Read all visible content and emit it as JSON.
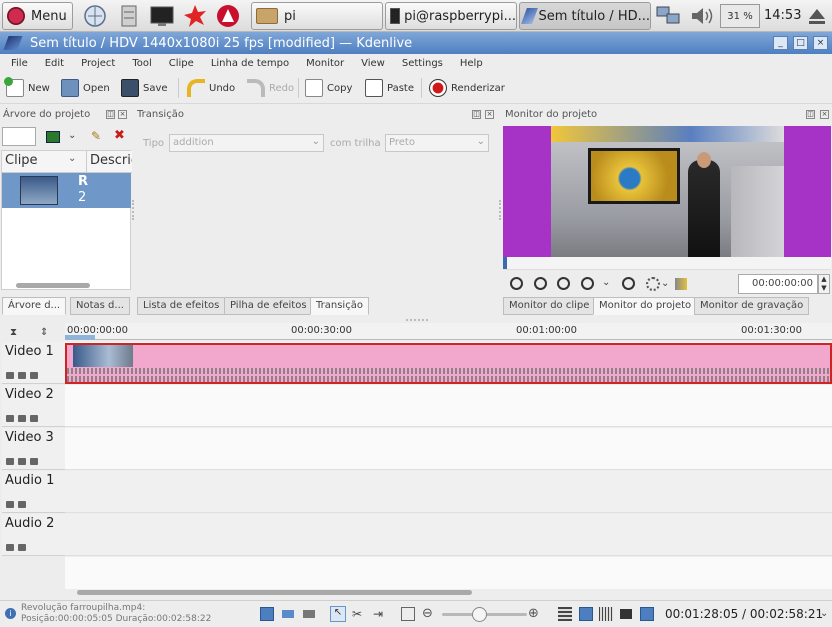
{
  "taskbar": {
    "menu_label": "Menu",
    "folder_label": "pi",
    "terminal_label": "pi@raspberrypi...",
    "kdenlive_label": "Sem título / HD...",
    "battery": "31 %",
    "clock": "14:53"
  },
  "window": {
    "title": "Sem título / HDV 1440x1080i 25 fps [modified] — Kdenlive"
  },
  "menu": [
    "File",
    "Edit",
    "Project",
    "Tool",
    "Clipe",
    "Linha de tempo",
    "Monitor",
    "View",
    "Settings",
    "Help"
  ],
  "toolbar": {
    "new": "New",
    "open": "Open",
    "save": "Save",
    "undo": "Undo",
    "redo": "Redo",
    "copy": "Copy",
    "paste": "Paste",
    "render": "Renderizar"
  },
  "project_tree": {
    "title": "Árvore do projeto",
    "col_clip": "Clipe",
    "col_desc": "Descric",
    "clip_line1": "R",
    "clip_line2": "2",
    "tabs": [
      "Árvore d...",
      "Notas d..."
    ]
  },
  "transition": {
    "title": "Transição",
    "type_label": "Tipo",
    "type_value": "addition",
    "track_label": "com trilha",
    "track_value": "Preto",
    "tabs": [
      "Lista de efeitos",
      "Pilha de efeitos",
      "Transição"
    ]
  },
  "monitor": {
    "title": "Monitor do projeto",
    "timecode": "00:00:00:00",
    "tabs": [
      "Monitor do clipe",
      "Monitor do projeto",
      "Monitor de gravação"
    ]
  },
  "timeline": {
    "ruler": [
      "00:00:00:00",
      "00:00:30:00",
      "00:01:00:00",
      "00:01:30:00"
    ],
    "tracks": [
      {
        "name": "Video 1"
      },
      {
        "name": "Video 2"
      },
      {
        "name": "Video 3"
      },
      {
        "name": "Audio 1"
      },
      {
        "name": "Audio 2"
      }
    ]
  },
  "status": {
    "clip_name": "Revolução farroupilha.mp4:",
    "clip_info": "Posição:00:00:05:05 Duração:00:02:58:22",
    "time": "00:01:28:05 / 00:02:58:21"
  },
  "colors": {
    "accent": "#5b8ac8",
    "clip_pink": "#f2a7cd",
    "monitor_bg": "#a632c6",
    "selection": "#6f97c7"
  }
}
